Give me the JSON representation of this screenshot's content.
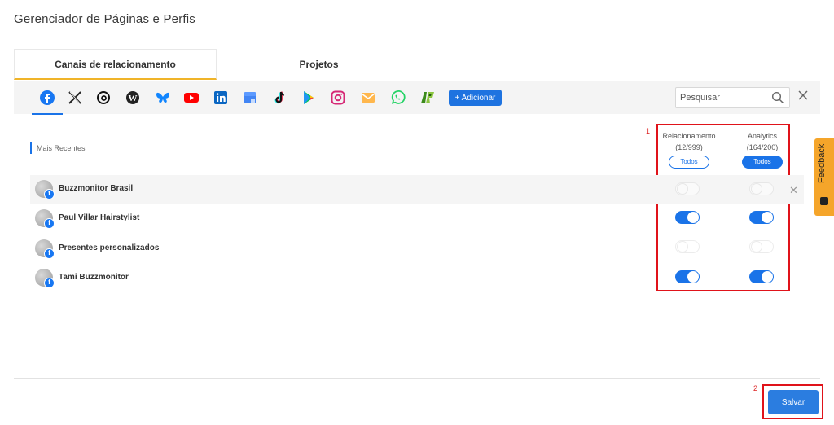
{
  "page": {
    "title": "Gerenciador de Páginas e Perfis"
  },
  "tabs": [
    {
      "label": "Canais de relacionamento",
      "active": true
    },
    {
      "label": "Projetos",
      "active": false
    }
  ],
  "networks": [
    {
      "name": "facebook-icon",
      "active": true
    },
    {
      "name": "x-icon"
    },
    {
      "name": "threads-icon"
    },
    {
      "name": "wordpress-icon"
    },
    {
      "name": "bluesky-icon"
    },
    {
      "name": "youtube-icon"
    },
    {
      "name": "linkedin-icon"
    },
    {
      "name": "google-business-icon"
    },
    {
      "name": "tiktok-icon"
    },
    {
      "name": "google-play-icon"
    },
    {
      "name": "instagram-icon"
    },
    {
      "name": "email-icon"
    },
    {
      "name": "whatsapp-icon"
    },
    {
      "name": "reclame-aqui-icon"
    }
  ],
  "toolbar": {
    "add_label": "+ Adicionar",
    "search_placeholder": "Pesquisar"
  },
  "list": {
    "section_label": "Mais Recentes",
    "columns": {
      "relationship": {
        "label": "Relacionamento",
        "count": "(12/999)",
        "all_label": "Todos"
      },
      "analytics": {
        "label": "Analytics",
        "count": "(164/200)",
        "all_label": "Todos"
      }
    },
    "rows": [
      {
        "name": "Buzzmonitor Brasil",
        "relationship": false,
        "analytics": false
      },
      {
        "name": "Paul Villar Hairstylist",
        "relationship": true,
        "analytics": true
      },
      {
        "name": "Presentes personalizados",
        "relationship": false,
        "analytics": false
      },
      {
        "name": "Tami Buzzmonitor",
        "relationship": true,
        "analytics": true
      }
    ]
  },
  "annotations": {
    "marker1": "1",
    "marker2": "2"
  },
  "feedback": {
    "label": "Feedback"
  },
  "footer": {
    "save_label": "Salvar"
  },
  "colors": {
    "accent": "#1a73e8",
    "tab_underline": "#f0b429",
    "highlight_border": "#e0131a",
    "feedback_bg": "#f5a52a"
  }
}
